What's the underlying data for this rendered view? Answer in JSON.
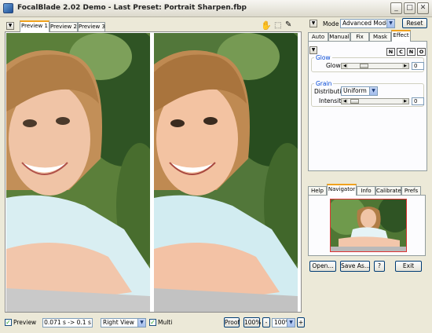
{
  "window": {
    "title": "FocalBlade 2.02 Demo - Last Preset: Portrait Sharpen.fbp",
    "minimize": "_",
    "maximize": "□",
    "close": "✕"
  },
  "preview_tabs": [
    "Preview 1",
    "Preview 2",
    "Preview 3"
  ],
  "top_arrow": "▼",
  "tools": {
    "hand": "✋",
    "marquee": "⬚",
    "eyedropper": "✎"
  },
  "right_panel": {
    "arrow": "▼",
    "mode_label": "Mode",
    "mode_value": "Advanced Mode",
    "reset_label": "Reset",
    "tabs": [
      "Auto",
      "Manual",
      "Fix",
      "Mask",
      "Effect"
    ],
    "effect": {
      "arrow": "▼",
      "mode_buttons": [
        "N",
        "C",
        "N",
        "O"
      ],
      "glow": {
        "group_title": "Glow",
        "label": "Glow",
        "value": "0",
        "level": 0.25,
        "left_arrow": "◀",
        "right_arrow": "▶"
      },
      "grain": {
        "group_title": "Grain",
        "distribution_label": "Distribution",
        "distribution_value": "Uniform",
        "intensity_label": "Intensity",
        "intensity_value": "0",
        "level": 0.05,
        "left_arrow": "◀",
        "right_arrow": "▶"
      }
    },
    "info_tabs": [
      "Help",
      "Navigator",
      "Info",
      "Calibrate",
      "Prefs"
    ]
  },
  "bottom_right_buttons": {
    "open": "Open...",
    "save_as": "Save As...",
    "help": "?",
    "exit": "Exit"
  },
  "status_bar": {
    "preview_label": "Preview",
    "preview_checked": "✓",
    "timing": "0.071 s -> 0.1 s",
    "view_value": "Right View",
    "multi_label": "Multi",
    "multi_checked": "✓",
    "proof_label": "Proof",
    "zoom_100_label": "100%",
    "zoom_minus": "-",
    "zoom_value": "100%",
    "zoom_plus": "+"
  },
  "combo_arrow": "▼",
  "colors": {
    "accent_tab": "#f0a21f",
    "window_bg": "#ece9d8",
    "group_title": "#0046d5"
  }
}
